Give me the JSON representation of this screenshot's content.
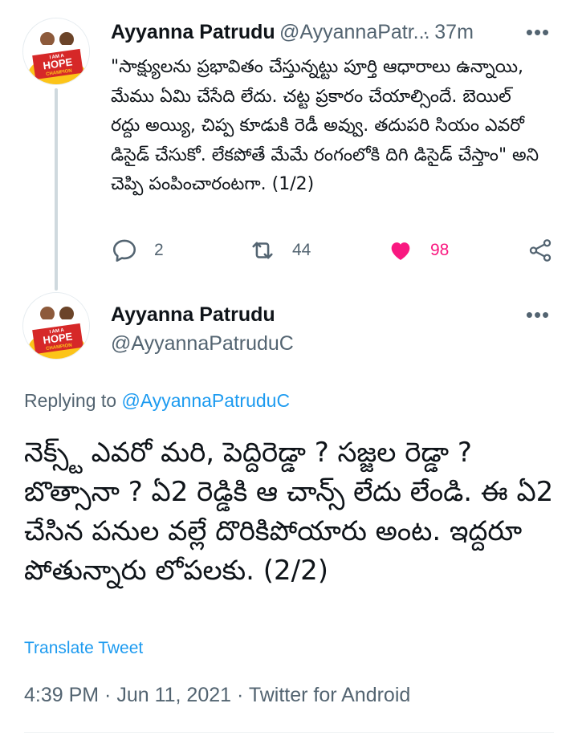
{
  "tweet1": {
    "avatar_text": [
      "I AM A",
      "HOPE",
      "CHAMPION"
    ],
    "author_name": "Ayyanna Patrudu",
    "author_handle": "@AyyannaPatr...",
    "time": "· 37m",
    "more_icon": "•••",
    "text": "\"సాక్ష్యులను ప్రభావితం చేస్తున్నట్టు పూర్తి ఆధారాలు ఉన్నాయి, మేము ఏమి చేసేది లేదు. చట్ట ప్రకారం చేయాల్సిందే. బెయిల్ రద్దు అయ్యి, చిప్ప కూడుకి రెడీ అవ్వు. తదుపరి సియం ఎవరో డిసైడ్ చేసుకో. లేకపోతే మేమే రంగంలోకి దిగి డిసైడ్ చేస్తాం\" అని చెప్పి పంపించారంటగా. (1/2)",
    "replies": "2",
    "retweets": "44",
    "likes": "98"
  },
  "tweet2": {
    "avatar_text": [
      "I AM A",
      "HOPE",
      "CHAMPION"
    ],
    "author_name": "Ayyanna Patrudu",
    "author_handle": "@AyyannaPatruduC",
    "more_icon": "•••",
    "replying_prefix": "Replying to ",
    "replying_to": "@AyyannaPatruduC",
    "text": "నెక్స్ట్ ఎవరో మరి, పెద్దిరెడ్డా ? సజ్జల రెడ్డా ? బొత్సానా ? ఏ2 రెడ్డికి ఆ చాన్స్ లేదు లేండి. ఈ ఏ2 చేసిన పనుల వల్లే దొరికిపోయారు అంట. ఇద్దరూ పోతున్నారు లోపలకు. (2/2)",
    "translate_label": "Translate Tweet",
    "timestamp": "4:39 PM · Jun 11, 2021 · ",
    "source": "Twitter for Android"
  },
  "colors": {
    "accent": "#1d9bf0",
    "like": "#f91880",
    "muted": "#536471",
    "avatar_bg": "#fcc419",
    "avatar_badge": "#d62828"
  },
  "icons": {
    "reply": "reply-icon",
    "retweet": "retweet-icon",
    "like": "heart-icon",
    "share": "share-icon",
    "more": "more-icon"
  }
}
